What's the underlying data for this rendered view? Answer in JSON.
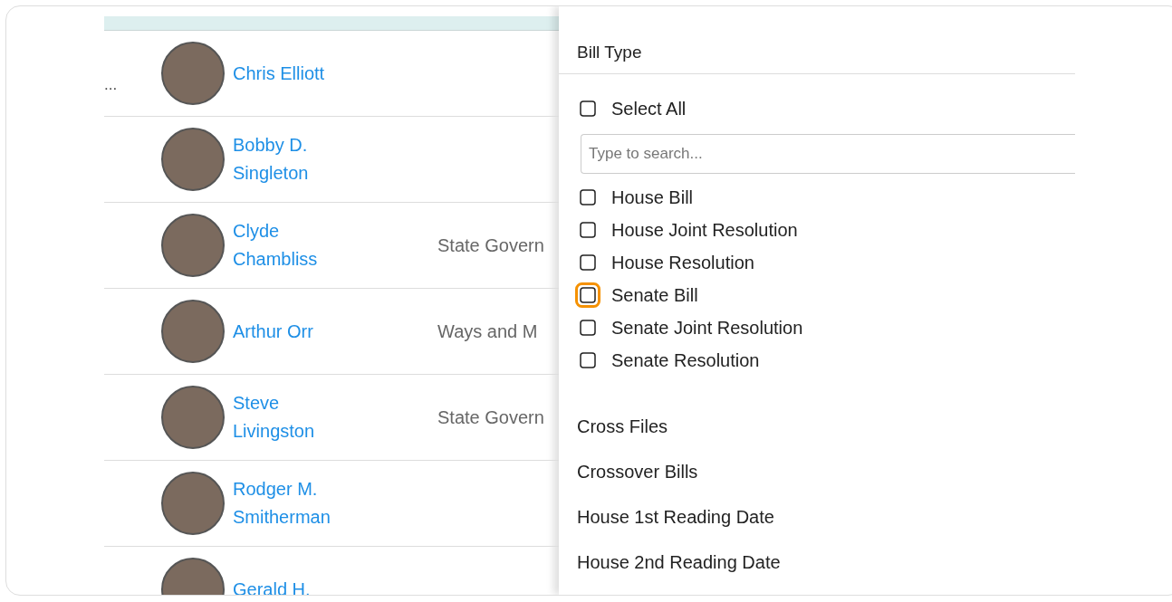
{
  "table": {
    "rows": [
      {
        "column_1": "...",
        "name": [
          "Chris Elliott"
        ],
        "committee": ""
      },
      {
        "column_1": "",
        "name": [
          "Bobby D.",
          "Singleton"
        ],
        "committee": ""
      },
      {
        "column_1": "",
        "name": [
          "Clyde",
          "Chambliss"
        ],
        "committee": "State Govern"
      },
      {
        "column_1": "",
        "name": [
          "Arthur Orr"
        ],
        "committee": "Ways and M"
      },
      {
        "column_1": "",
        "name": [
          "Steve",
          "Livingston"
        ],
        "committee": "State Govern"
      },
      {
        "column_1": "",
        "name": [
          "Rodger M.",
          "Smitherman"
        ],
        "committee": ""
      },
      {
        "column_1": "",
        "name": [
          "Gerald H."
        ],
        "committee": ""
      }
    ]
  },
  "filter_panel": {
    "section_title": "Bill Type",
    "select_all": {
      "label": "Select All",
      "checked": false,
      "focused": false
    },
    "search": {
      "placeholder": "Type to search..."
    },
    "options": [
      {
        "label": "House Bill",
        "checked": false,
        "focused": false
      },
      {
        "label": "House Joint Resolution",
        "checked": false,
        "focused": false
      },
      {
        "label": "House Resolution",
        "checked": false,
        "focused": false
      },
      {
        "label": "Senate Bill",
        "checked": false,
        "focused": true
      },
      {
        "label": "Senate Joint Resolution",
        "checked": false,
        "focused": false
      },
      {
        "label": "Senate Resolution",
        "checked": false,
        "focused": false
      }
    ],
    "sections": [
      "Cross Files",
      "Crossover Bills",
      "House 1st Reading Date",
      "House 2nd Reading Date"
    ]
  }
}
